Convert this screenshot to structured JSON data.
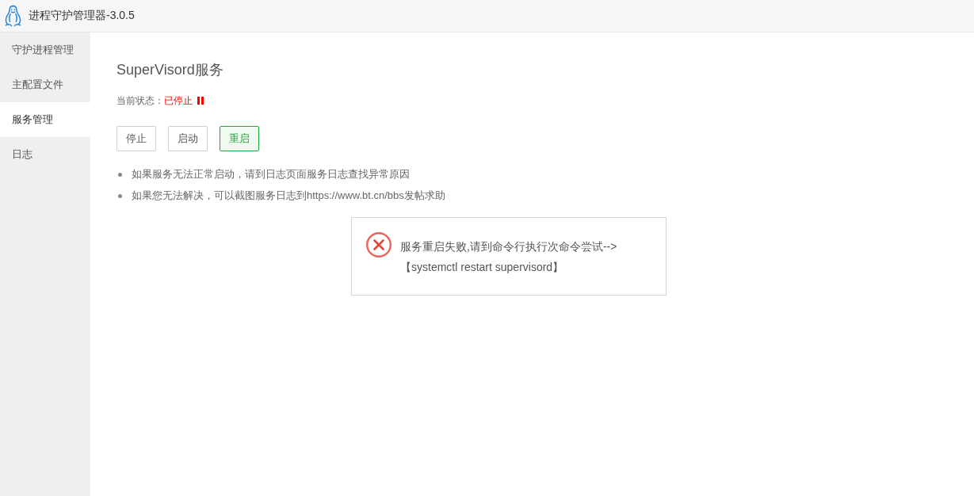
{
  "window": {
    "title": "进程守护管理器-3.0.5"
  },
  "sidebar": {
    "items": [
      {
        "label": "守护进程管理",
        "selected": false
      },
      {
        "label": "主配置文件",
        "selected": false
      },
      {
        "label": "服务管理",
        "selected": true
      },
      {
        "label": "日志",
        "selected": false
      }
    ]
  },
  "service": {
    "heading": "SuperVisord服务",
    "status": {
      "label": "当前状态：",
      "value": "已停止",
      "running": false
    },
    "buttons": [
      {
        "label": "停止",
        "selected": false
      },
      {
        "label": "启动",
        "selected": false
      },
      {
        "label": "重启",
        "selected": true
      }
    ],
    "notes": [
      "如果服务无法正常启动，请到日志页面服务日志查找异常原因",
      "如果您无法解决，可以截图服务日志到https://www.bt.cn/bbs发帖求助"
    ]
  },
  "message": {
    "kind": "error",
    "lines": [
      "服务重启失败,请到命令行执行次命令尝试-->",
      "【systemctl restart supervisord】"
    ]
  }
}
